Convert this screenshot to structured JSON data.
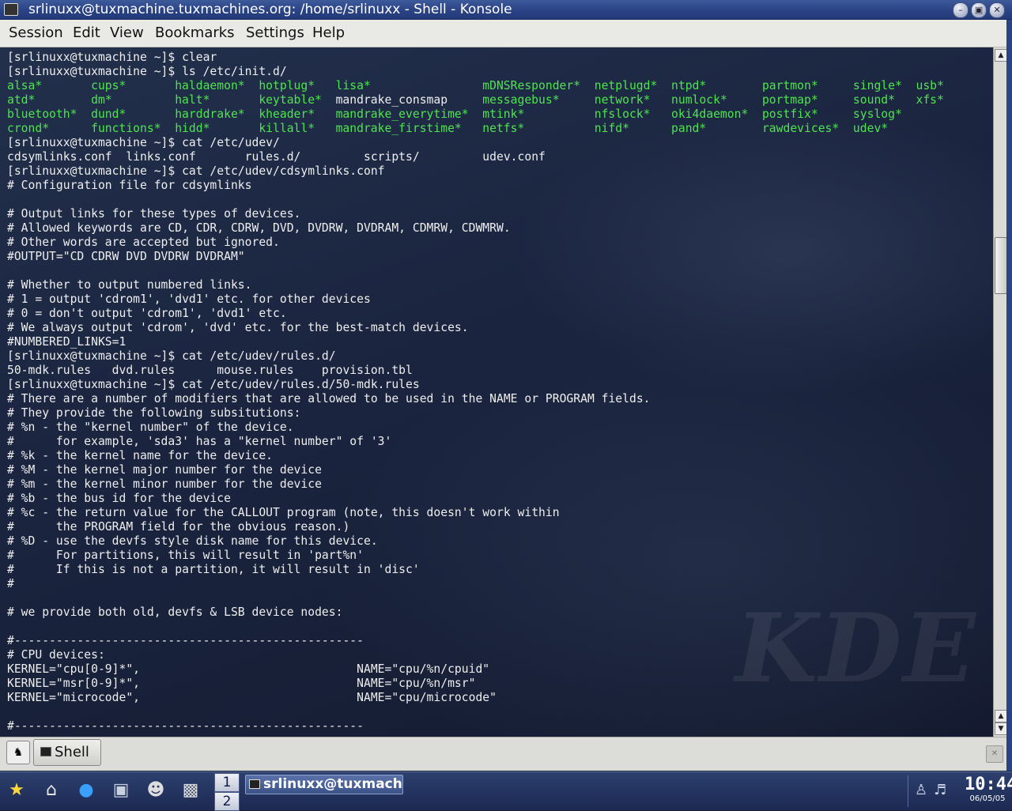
{
  "window": {
    "title": "srlinuxx@tuxmachine.tuxmachines.org: /home/srlinuxx - Shell - Konsole",
    "buttons": [
      "minimize",
      "maximize",
      "close"
    ]
  },
  "menu": [
    "Session",
    "Edit",
    "View",
    "Bookmarks",
    "Settings",
    "Help"
  ],
  "terminal": {
    "watermark": "KDE",
    "lines": [
      [
        {
          "t": "[srlinuxx@tuxmachine ~]$ clear"
        }
      ],
      [
        {
          "t": "[srlinuxx@tuxmachine ~]$ ls /etc/init.d/"
        }
      ],
      [
        {
          "t": "alsa*",
          "c": "green"
        },
        {
          "t": "cups*",
          "c": "green"
        },
        {
          "t": "haldaemon*",
          "c": "green"
        },
        {
          "t": "hotplug*",
          "c": "green"
        },
        {
          "t": "lisa*",
          "c": "green"
        },
        {
          "t": "mDNSResponder*",
          "c": "green"
        },
        {
          "t": "netplugd*",
          "c": "green"
        },
        {
          "t": "ntpd*",
          "c": "green"
        },
        {
          "t": "partmon*",
          "c": "green"
        },
        {
          "t": "single*",
          "c": "green"
        },
        {
          "t": "usb*",
          "c": "green"
        }
      ],
      [
        {
          "t": "atd*",
          "c": "green"
        },
        {
          "t": "dm*",
          "c": "green"
        },
        {
          "t": "halt*",
          "c": "green"
        },
        {
          "t": "keytable*",
          "c": "green"
        },
        {
          "t": "mandrake_consmap",
          "c": "white"
        },
        {
          "t": "messagebus*",
          "c": "green"
        },
        {
          "t": "network*",
          "c": "green"
        },
        {
          "t": "numlock*",
          "c": "green"
        },
        {
          "t": "portmap*",
          "c": "green"
        },
        {
          "t": "sound*",
          "c": "green"
        },
        {
          "t": "xfs*",
          "c": "green"
        }
      ],
      [
        {
          "t": "bluetooth*",
          "c": "green"
        },
        {
          "t": "dund*",
          "c": "green"
        },
        {
          "t": "harddrake*",
          "c": "green"
        },
        {
          "t": "kheader*",
          "c": "green"
        },
        {
          "t": "mandrake_everytime*",
          "c": "green"
        },
        {
          "t": "mtink*",
          "c": "green"
        },
        {
          "t": "nfslock*",
          "c": "green"
        },
        {
          "t": "oki4daemon*",
          "c": "green"
        },
        {
          "t": "postfix*",
          "c": "green"
        },
        {
          "t": "syslog*",
          "c": "green"
        },
        {
          "t": ""
        }
      ],
      [
        {
          "t": "crond*",
          "c": "green"
        },
        {
          "t": "functions*",
          "c": "green"
        },
        {
          "t": "hidd*",
          "c": "green"
        },
        {
          "t": "killall*",
          "c": "green"
        },
        {
          "t": "mandrake_firstime*",
          "c": "green"
        },
        {
          "t": "netfs*",
          "c": "green"
        },
        {
          "t": "nifd*",
          "c": "green"
        },
        {
          "t": "pand*",
          "c": "green"
        },
        {
          "t": "rawdevices*",
          "c": "green"
        },
        {
          "t": "udev*",
          "c": "green"
        },
        {
          "t": ""
        }
      ],
      [
        {
          "t": "[srlinuxx@tuxmachine ~]$ cat /etc/udev/"
        }
      ],
      [
        {
          "t": "cdsymlinks.conf  links.conf       rules.d/         scripts/         udev.conf"
        }
      ],
      [
        {
          "t": "[srlinuxx@tuxmachine ~]$ cat /etc/udev/cdsymlinks.conf"
        }
      ],
      [
        {
          "t": "# Configuration file for cdsymlinks"
        }
      ],
      [
        {
          "t": ""
        }
      ],
      [
        {
          "t": "# Output links for these types of devices."
        }
      ],
      [
        {
          "t": "# Allowed keywords are CD, CDR, CDRW, DVD, DVDRW, DVDRAM, CDMRW, CDWMRW."
        }
      ],
      [
        {
          "t": "# Other words are accepted but ignored."
        }
      ],
      [
        {
          "t": "#OUTPUT=\"CD CDRW DVD DVDRW DVDRAM\""
        }
      ],
      [
        {
          "t": ""
        }
      ],
      [
        {
          "t": "# Whether to output numbered links."
        }
      ],
      [
        {
          "t": "# 1 = output 'cdrom1', 'dvd1' etc. for other devices"
        }
      ],
      [
        {
          "t": "# 0 = don't output 'cdrom1', 'dvd1' etc."
        }
      ],
      [
        {
          "t": "# We always output 'cdrom', 'dvd' etc. for the best-match devices."
        }
      ],
      [
        {
          "t": "#NUMBERED_LINKS=1"
        }
      ],
      [
        {
          "t": "[srlinuxx@tuxmachine ~]$ cat /etc/udev/rules.d/"
        }
      ],
      [
        {
          "t": "50-mdk.rules   dvd.rules      mouse.rules    provision.tbl"
        }
      ],
      [
        {
          "t": "[srlinuxx@tuxmachine ~]$ cat /etc/udev/rules.d/50-mdk.rules"
        }
      ],
      [
        {
          "t": "# There are a number of modifiers that are allowed to be used in the NAME or PROGRAM fields."
        }
      ],
      [
        {
          "t": "# They provide the following subsitutions:"
        }
      ],
      [
        {
          "t": "# %n - the \"kernel number\" of the device."
        }
      ],
      [
        {
          "t": "#      for example, 'sda3' has a \"kernel number\" of '3'"
        }
      ],
      [
        {
          "t": "# %k - the kernel name for the device."
        }
      ],
      [
        {
          "t": "# %M - the kernel major number for the device"
        }
      ],
      [
        {
          "t": "# %m - the kernel minor number for the device"
        }
      ],
      [
        {
          "t": "# %b - the bus id for the device"
        }
      ],
      [
        {
          "t": "# %c - the return value for the CALLOUT program (note, this doesn't work within"
        }
      ],
      [
        {
          "t": "#      the PROGRAM field for the obvious reason.)"
        }
      ],
      [
        {
          "t": "# %D - use the devfs style disk name for this device."
        }
      ],
      [
        {
          "t": "#      For partitions, this will result in 'part%n'"
        }
      ],
      [
        {
          "t": "#      If this is not a partition, it will result in 'disc'"
        }
      ],
      [
        {
          "t": "#"
        }
      ],
      [
        {
          "t": ""
        }
      ],
      [
        {
          "t": "# we provide both old, devfs & LSB device nodes:"
        }
      ],
      [
        {
          "t": ""
        }
      ],
      [
        {
          "t": "#--------------------------------------------------"
        }
      ],
      [
        {
          "t": "# CPU devices:"
        }
      ],
      [
        {
          "t": "KERNEL=\"cpu[0-9]*\",                               NAME=\"cpu/%n/cpuid\""
        }
      ],
      [
        {
          "t": "KERNEL=\"msr[0-9]*\",                               NAME=\"cpu/%n/msr\""
        }
      ],
      [
        {
          "t": "KERNEL=\"microcode\",                               NAME=\"cpu/microcode\""
        }
      ],
      [
        {
          "t": ""
        }
      ],
      [
        {
          "t": "#--------------------------------------------------"
        }
      ]
    ]
  },
  "tabs": {
    "new_session_icon": "new-session-icon",
    "items": [
      {
        "label": "Shell",
        "icon": "terminal-icon"
      }
    ],
    "close_icon": "close-session-icon"
  },
  "panel": {
    "launchers": [
      "kmenu-star-icon",
      "home-icon",
      "browser-globe-icon",
      "image-viewer-icon",
      "gimp-icon",
      "konsole-icon"
    ],
    "pager": [
      "1",
      "2"
    ],
    "taskbar": [
      {
        "label": "srlinuxx@tuxmachi",
        "icon": "terminal-icon"
      }
    ],
    "tray_icons": [
      "user-icon",
      "volume-icon"
    ],
    "clock_time": "10:44",
    "clock_date": "06/05/05"
  },
  "colors": {
    "terminal_green": "#4ee44e",
    "terminal_text": "#eeeeee",
    "titlebar": "#2a4385"
  }
}
